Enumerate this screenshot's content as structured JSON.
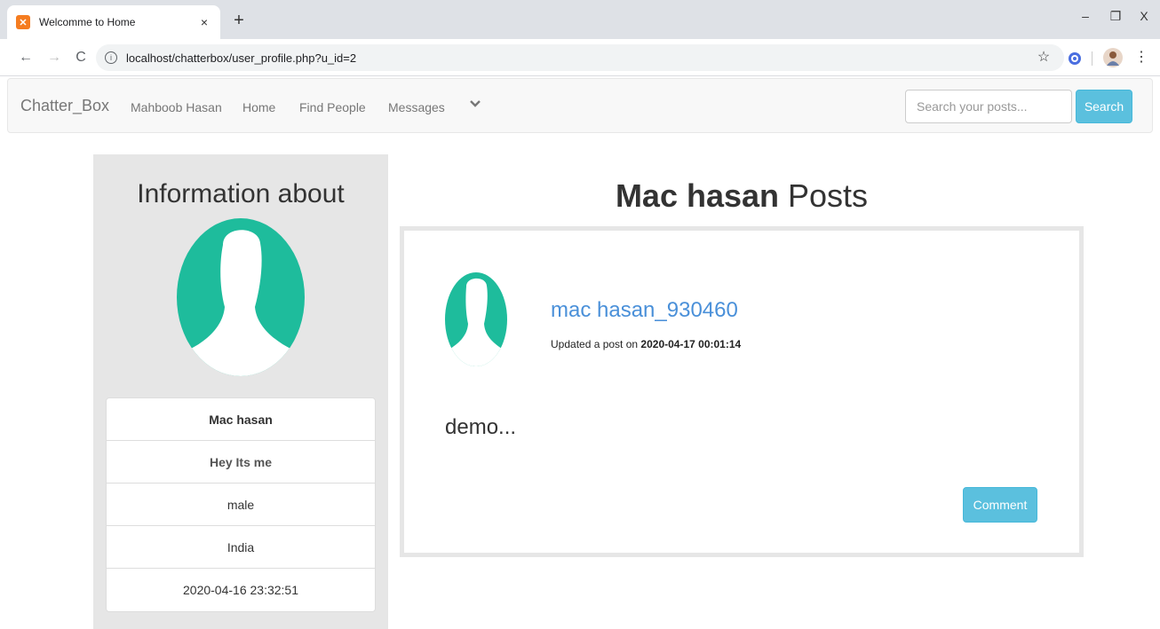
{
  "browser": {
    "tab_title": "Welcomme to Home",
    "tab_close": "×",
    "new_tab": "+",
    "url_host": "localhost",
    "url_path": "/chatterbox/user_profile.php?u_id=2",
    "back": "←",
    "forward": "→",
    "reload": "C",
    "minimize": "–",
    "restore": "❐",
    "close": "X",
    "star": "☆",
    "menu": "⋮"
  },
  "navbar": {
    "brand": "Chatter_Box",
    "links": [
      "Mahboob Hasan",
      "Home",
      "Find People",
      "Messages"
    ],
    "caret": "❯",
    "search_placeholder": "Search your posts...",
    "search_button": "Search"
  },
  "profile": {
    "heading": "Information about",
    "name": "Mac hasan",
    "description": "Hey Its me",
    "gender": "male",
    "country": "India",
    "joined": "2020-04-16 23:32:51"
  },
  "posts": {
    "title_bold": "Mac hasan",
    "title_rest": " Posts",
    "items": [
      {
        "username": "mac hasan_930460",
        "meta_prefix": "Updated a post on ",
        "timestamp": "2020-04-17 00:01:14",
        "content": "demo...",
        "comment_label": "Comment"
      }
    ]
  },
  "colors": {
    "avatar": "#1ebc9c",
    "accent_button": "#5bc0de",
    "link": "#4a90d9"
  }
}
